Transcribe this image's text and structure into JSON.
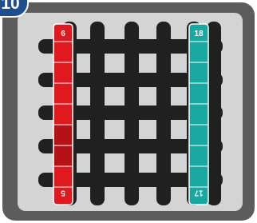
{
  "level": {
    "number": "10"
  },
  "colors": {
    "background_outer": "#5c5c5c",
    "background_inner": "#d4d4d4",
    "grid_bar": "#202020",
    "strip_red": "#e0191f",
    "strip_red_dark": "#b51218",
    "strip_teal": "#1aa7a1",
    "badge": "#1f4e8f"
  },
  "grid": {
    "vertical_bars": 6,
    "horizontal_bars": 5
  },
  "strips": [
    {
      "name": "red",
      "color": "red",
      "top_number": "6",
      "bottom_number": "5",
      "segments": [
        "plain",
        "plain",
        "plain",
        "plain",
        "dark",
        "dark",
        "plain"
      ]
    },
    {
      "name": "teal",
      "color": "teal",
      "top_number": "18",
      "bottom_number": "17",
      "segments": [
        "plain",
        "plain",
        "plain",
        "plain",
        "plain",
        "plain",
        "plain"
      ]
    }
  ]
}
